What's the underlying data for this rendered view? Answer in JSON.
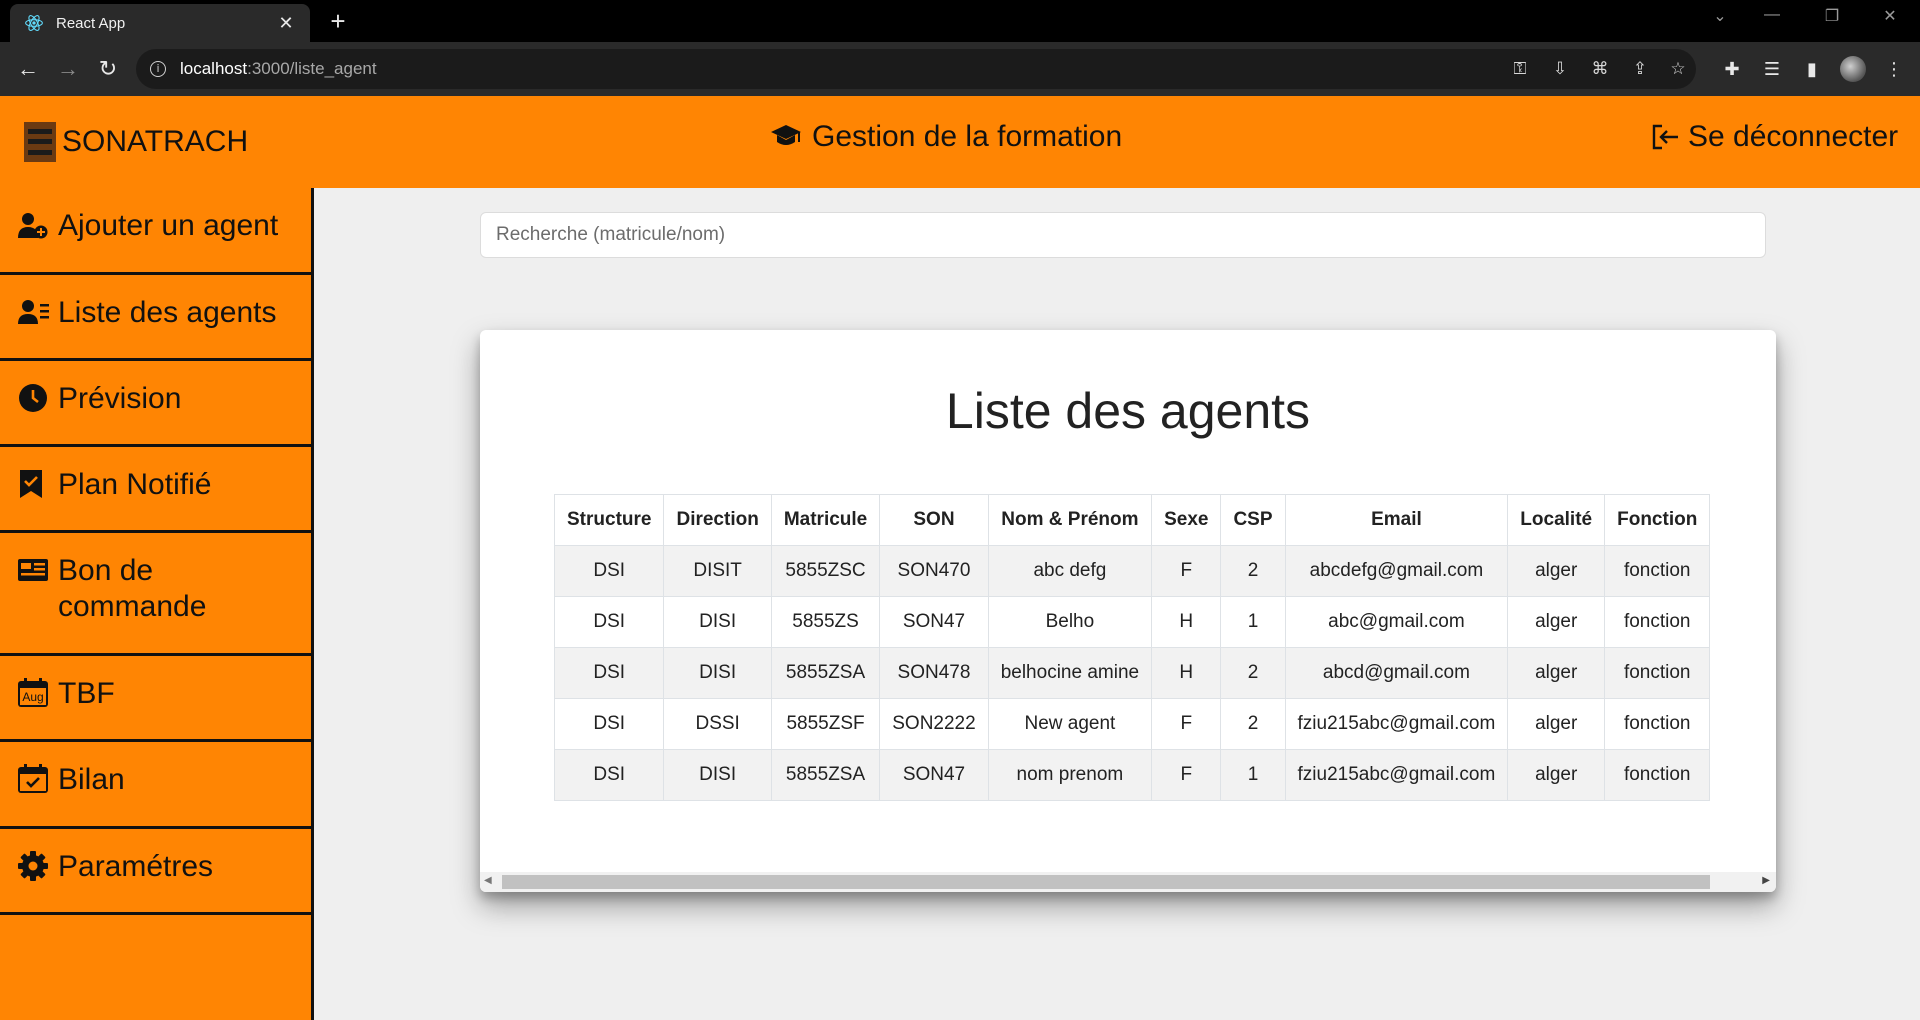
{
  "browser": {
    "tab_title": "React App",
    "url_host": "localhost",
    "url_path": ":3000/liste_agent"
  },
  "header": {
    "brand": "SONATRACH",
    "title": "Gestion de la formation",
    "logout": "Se déconnecter",
    "accent_color": "#ff8503"
  },
  "sidebar": {
    "items": [
      {
        "label": "Ajouter un agent",
        "icon": "user-plus-icon"
      },
      {
        "label": "Liste des agents",
        "icon": "user-list-icon"
      },
      {
        "label": "Prévision",
        "icon": "clock-icon"
      },
      {
        "label": "Plan Notifié",
        "icon": "bookmark-check-icon"
      },
      {
        "label": "Bon de commande",
        "icon": "order-card-icon"
      },
      {
        "label": "TBF",
        "icon": "calendar-month-icon",
        "badge": "Aug"
      },
      {
        "label": "Bilan",
        "icon": "calendar-check-icon"
      },
      {
        "label": "Paramétres",
        "icon": "gear-icon"
      }
    ]
  },
  "search": {
    "placeholder": "Recherche (matricule/nom)"
  },
  "card": {
    "title": "Liste des agents"
  },
  "table": {
    "columns": [
      "Structure",
      "Direction",
      "Matricule",
      "SON",
      "Nom & Prénom",
      "Sexe",
      "CSP",
      "Email",
      "Localité",
      "Fonction"
    ],
    "rows": [
      [
        "DSI",
        "DISIT",
        "5855ZSC",
        "SON470",
        "abc defg",
        "F",
        "2",
        "abcdefg@gmail.com",
        "alger",
        "fonction"
      ],
      [
        "DSI",
        "DISI",
        "5855ZS",
        "SON47",
        "Belho",
        "H",
        "1",
        "abc@gmail.com",
        "alger",
        "fonction"
      ],
      [
        "DSI",
        "DISI",
        "5855ZSA",
        "SON478",
        "belhocine amine",
        "H",
        "2",
        "abcd@gmail.com",
        "alger",
        "fonction"
      ],
      [
        "DSI",
        "DSSI",
        "5855ZSF",
        "SON2222",
        "New agent",
        "F",
        "2",
        "fziu215abc@gmail.com",
        "alger",
        "fonction"
      ],
      [
        "DSI",
        "DISI",
        "5855ZSA",
        "SON47",
        "nom prenom",
        "F",
        "1",
        "fziu215abc@gmail.com",
        "alger",
        "fonction"
      ]
    ]
  }
}
